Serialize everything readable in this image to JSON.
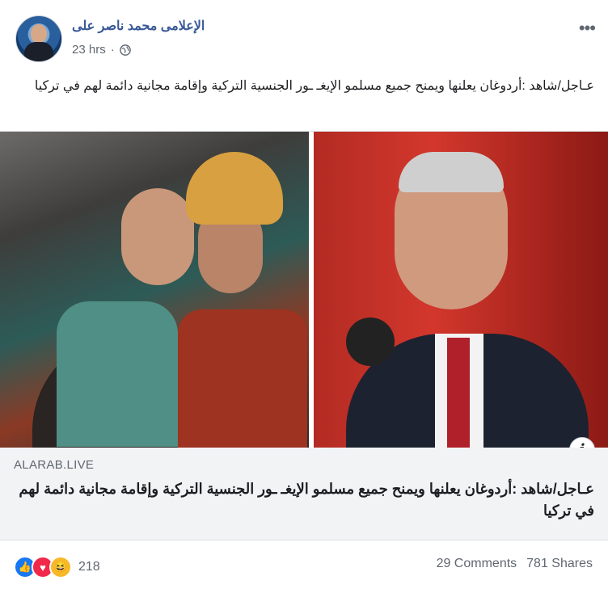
{
  "post": {
    "author": "الإعلامى محمد ناصر على",
    "time": "23 hrs",
    "separator": "·",
    "audience_icon": "globe-icon",
    "more_icon": "more-options-icon",
    "caption": "عـاجل/شاهد :أردوغان يعلنها ويمنح جميع مسلمو الإيغـ ـور الجنسية التركية وإقامة مجانية دائمة لهم في تركيا"
  },
  "link_preview": {
    "info_label": "i",
    "domain": "ALARAB.LIVE",
    "title": "عـاجل/شاهد :أردوغان يعلنها ويمنح جميع مسلمو الإيغـ ـور الجنسية التركية وإقامة مجانية دائمة لهم في تركيا"
  },
  "footer": {
    "reactions": [
      "like-icon",
      "love-icon",
      "haha-icon"
    ],
    "reaction_count": "218",
    "comments": "29 Comments",
    "shares": "781 Shares"
  },
  "colors": {
    "author": "#385898",
    "like": "#1877f2",
    "love": "#f02849",
    "haha": "#f7b928"
  }
}
